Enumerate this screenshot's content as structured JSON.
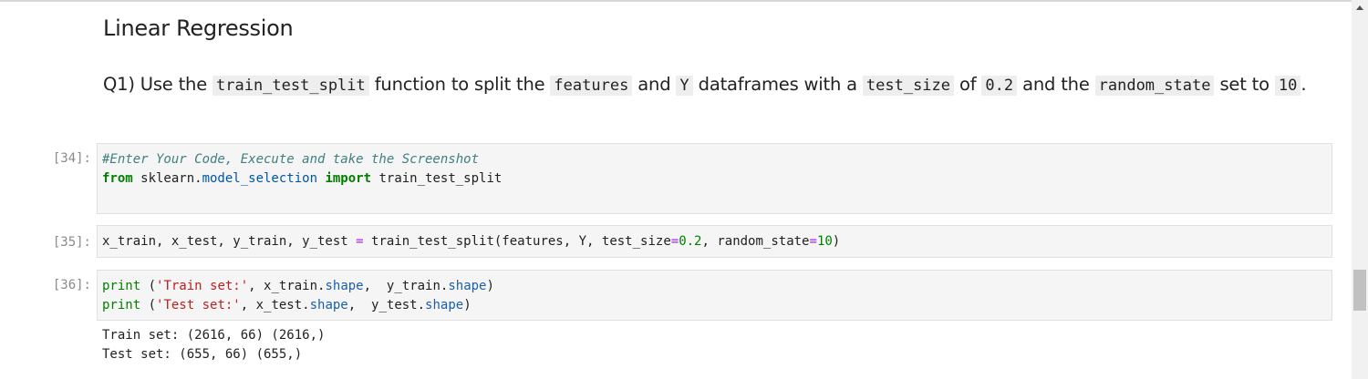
{
  "markdown": {
    "title": "Linear Regression",
    "question": [
      {
        "t": "text",
        "v": "Q1) Use the "
      },
      {
        "t": "code",
        "v": "train_test_split"
      },
      {
        "t": "text",
        "v": " function to split the "
      },
      {
        "t": "code",
        "v": "features"
      },
      {
        "t": "text",
        "v": " and "
      },
      {
        "t": "code",
        "v": "Y"
      },
      {
        "t": "text",
        "v": " dataframes with a "
      },
      {
        "t": "code",
        "v": "test_size"
      },
      {
        "t": "text",
        "v": " of "
      },
      {
        "t": "code",
        "v": "0.2"
      },
      {
        "t": "text",
        "v": " and the "
      },
      {
        "t": "code",
        "v": "random_state"
      },
      {
        "t": "text",
        "v": " set to "
      },
      {
        "t": "code",
        "v": "10"
      },
      {
        "t": "text",
        "v": "."
      }
    ]
  },
  "cells": [
    {
      "prompt": "[34]:",
      "lines": [
        [
          {
            "c": "cm",
            "v": "#Enter Your Code, Execute and take the Screenshot"
          }
        ],
        [
          {
            "c": "kw",
            "v": "from"
          },
          {
            "c": "",
            "v": " sklearn."
          },
          {
            "c": "mod",
            "v": "model_selection"
          },
          {
            "c": "",
            "v": " "
          },
          {
            "c": "kw",
            "v": "import"
          },
          {
            "c": "",
            "v": " train_test_split"
          }
        ]
      ]
    },
    {
      "prompt": "[35]:",
      "lines": [
        [
          {
            "c": "",
            "v": "x_train, x_test, y_train, y_test "
          },
          {
            "c": "op",
            "v": "="
          },
          {
            "c": "",
            "v": " train_test_split(features, Y, test_size"
          },
          {
            "c": "op",
            "v": "="
          },
          {
            "c": "num",
            "v": "0.2"
          },
          {
            "c": "",
            "v": ", random_state"
          },
          {
            "c": "op",
            "v": "="
          },
          {
            "c": "num",
            "v": "10"
          },
          {
            "c": "",
            "v": ")"
          }
        ]
      ]
    },
    {
      "prompt": "[36]:",
      "lines": [
        [
          {
            "c": "bi",
            "v": "print"
          },
          {
            "c": "",
            "v": " ("
          },
          {
            "c": "str",
            "v": "'Train set:'"
          },
          {
            "c": "",
            "v": ", x_train."
          },
          {
            "c": "attr",
            "v": "shape"
          },
          {
            "c": "",
            "v": ",  y_train."
          },
          {
            "c": "attr",
            "v": "shape"
          },
          {
            "c": "",
            "v": ")"
          }
        ],
        [
          {
            "c": "bi",
            "v": "print"
          },
          {
            "c": "",
            "v": " ("
          },
          {
            "c": "str",
            "v": "'Test set:'"
          },
          {
            "c": "",
            "v": ", x_test."
          },
          {
            "c": "attr",
            "v": "shape"
          },
          {
            "c": "",
            "v": ",  y_test."
          },
          {
            "c": "attr",
            "v": "shape"
          },
          {
            "c": "",
            "v": ")"
          }
        ]
      ]
    }
  ],
  "output": [
    "Train set: (2616, 66) (2616,)",
    "Test set: (655, 66) (655,)"
  ]
}
